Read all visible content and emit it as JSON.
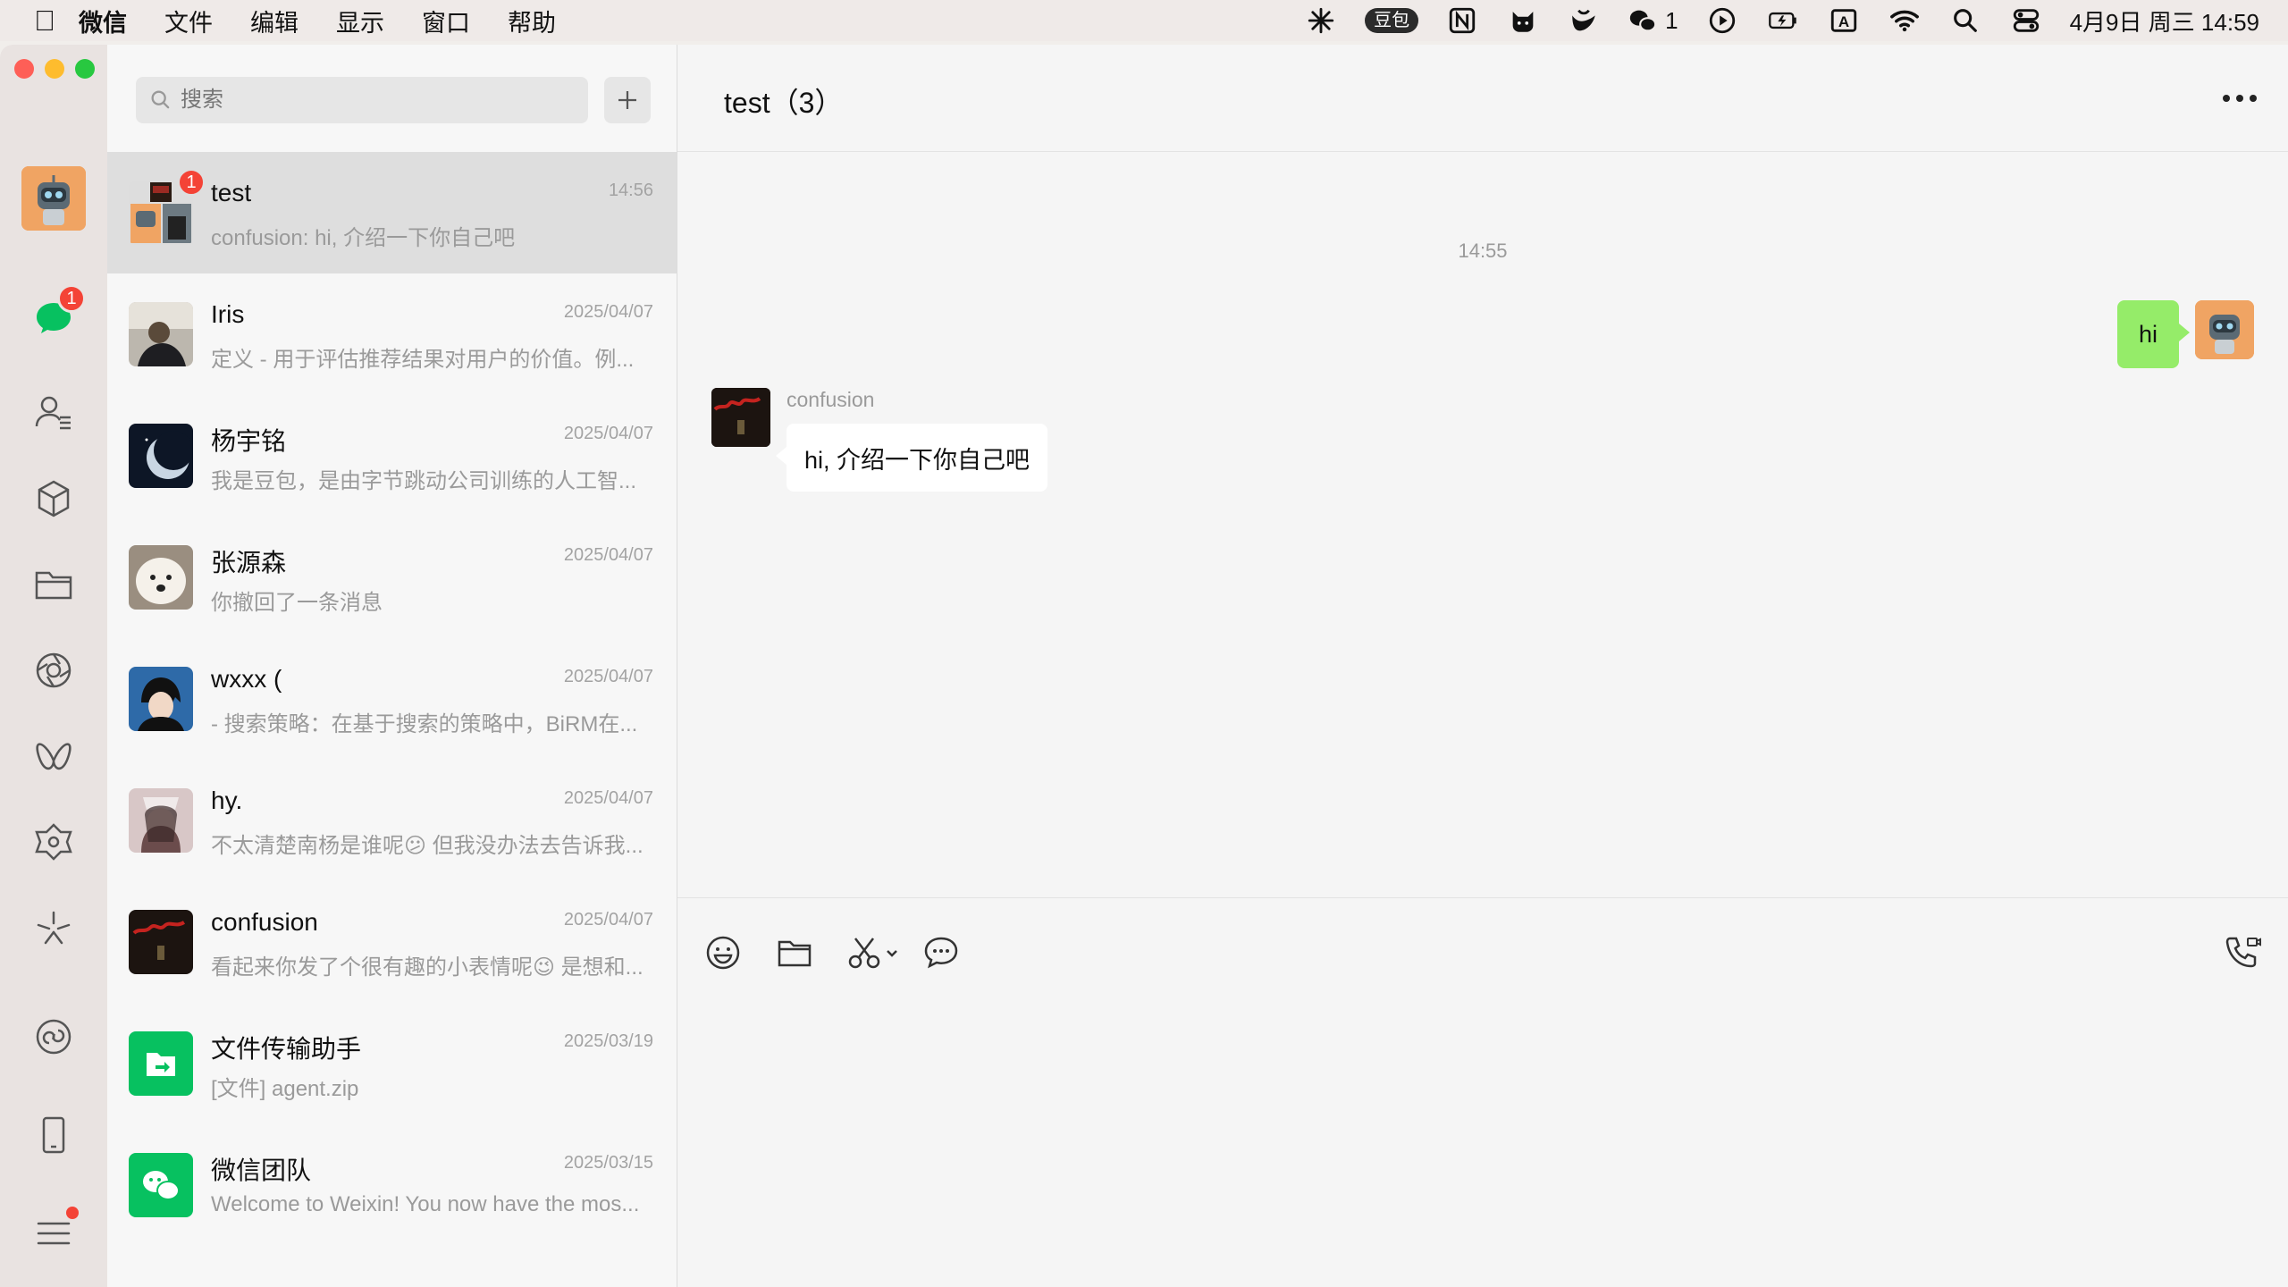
{
  "menubar": {
    "app_name": "微信",
    "menus": [
      "文件",
      "编辑",
      "显示",
      "窗口",
      "帮助"
    ],
    "doubao_label": "豆包",
    "wechat_count": "1",
    "input_method": "A",
    "datetime": "4月9日 周三  14:59"
  },
  "rail": {
    "chat_badge": "1"
  },
  "list": {
    "search_placeholder": "搜索",
    "chats": [
      {
        "name": "test",
        "time": "14:56",
        "preview": "confusion: hi, 介绍一下你自己吧",
        "badge": "1"
      },
      {
        "name": "Iris",
        "time": "2025/04/07",
        "preview": "定义 - 用于评估推荐结果对用户的价值。例..."
      },
      {
        "name": "杨宇铭",
        "time": "2025/04/07",
        "preview": "我是豆包，是由字节跳动公司训练的人工智..."
      },
      {
        "name": "张源森",
        "time": "2025/04/07",
        "preview": "你撤回了一条消息"
      },
      {
        "name": "wxxx (",
        "time": "2025/04/07",
        "preview": "- 搜索策略：在基于搜索的策略中，BiRM在..."
      },
      {
        "name": "hy.",
        "time": "2025/04/07",
        "preview": "不太清楚南杨是谁呢😕 但我没办法去告诉我..."
      },
      {
        "name": "confusion",
        "time": "2025/04/07",
        "preview": "看起来你发了个很有趣的小表情呢😉 是想和..."
      },
      {
        "name": "文件传输助手",
        "time": "2025/03/19",
        "preview": "[文件] agent.zip"
      },
      {
        "name": "微信团队",
        "time": "2025/03/15",
        "preview": "Welcome to Weixin! You now have the mos..."
      }
    ]
  },
  "conversation": {
    "title": "test（3）",
    "time_divider": "14:55",
    "outgoing_text": "hi",
    "incoming_sender": "confusion",
    "incoming_text": "hi, 介绍一下你自己吧"
  },
  "colors": {
    "bubble_out": "#95ec69",
    "badge": "#f44336",
    "wechat_green": "#07c160"
  }
}
